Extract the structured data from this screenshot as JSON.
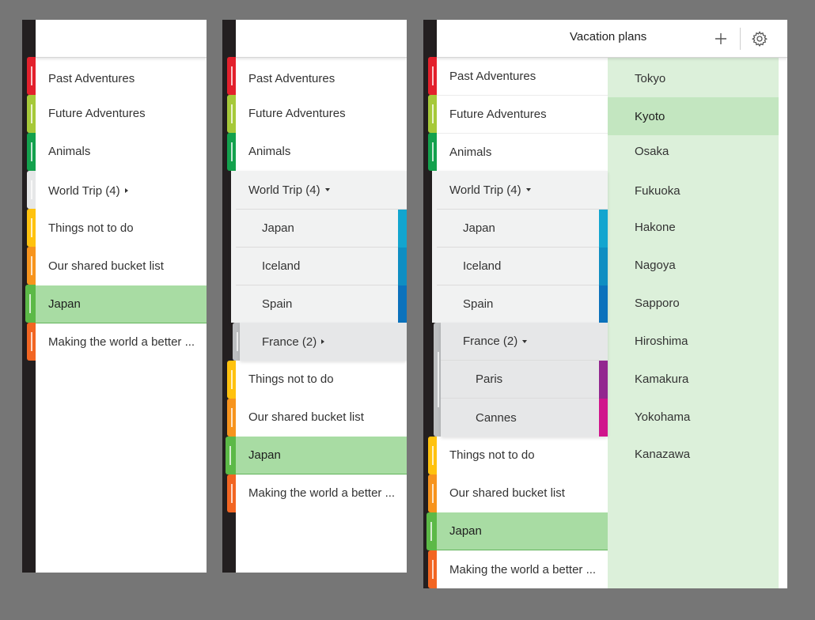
{
  "sections": {
    "past": "Past Adventures",
    "future": "Future Adventures",
    "animals": "Animals",
    "world_trip_4": "World Trip (4)",
    "things": "Things not to do",
    "bucket": "Our shared bucket list",
    "japan": "Japan",
    "making": "Making the world a better ..."
  },
  "world_trip_children": {
    "japan": "Japan",
    "iceland": "Iceland",
    "spain": "Spain",
    "france_2": "France (2)"
  },
  "france_children": {
    "paris": "Paris",
    "cannes": "Cannes"
  },
  "header": {
    "title": "Vacation plans"
  },
  "pages": [
    "Tokyo",
    "Kyoto",
    "Osaka",
    "Fukuoka",
    "Hakone",
    "Nagoya",
    "Sapporo",
    "Hiroshima",
    "Kamakura",
    "Yokohama",
    "Kanazawa"
  ],
  "selected_page": "Kyoto",
  "colors": {
    "past": "#e3202c",
    "future": "#a6c939",
    "animals": "#13a14d",
    "world_trip": "#e6e7e8",
    "things": "#ffc20e",
    "bucket": "#f7941d",
    "japan_section": "#5cb947",
    "making": "#f26522",
    "sub_japan": "#12a5cf",
    "sub_iceland": "#0e8ec2",
    "sub_spain": "#0b72bc",
    "sub_france": "#bcbec0",
    "paris": "#92278f",
    "cannes": "#d0158c",
    "selected_bg": "#a8dca3",
    "pages_bg": "#dcf0da"
  },
  "icons": {
    "add": "plus-icon",
    "settings": "gear-icon",
    "expand_collapsed": "caret-right-icon",
    "expand_open": "caret-down-icon"
  }
}
